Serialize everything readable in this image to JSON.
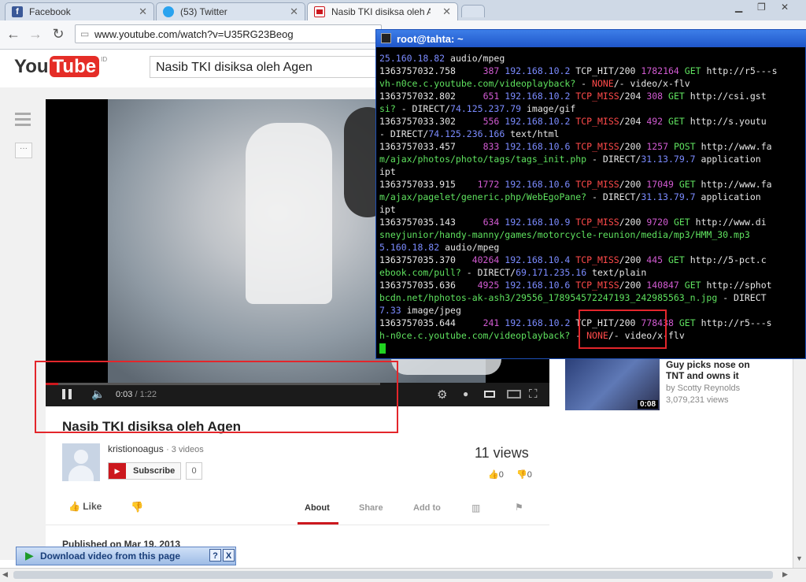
{
  "browser": {
    "tabs": [
      {
        "label": "Facebook",
        "icon": "facebook-icon",
        "color": "#3b5998"
      },
      {
        "label": "(53) Twitter",
        "icon": "twitter-icon",
        "color": "#2aa3ef"
      },
      {
        "label": "Nasib TKI disiksa oleh Agen -",
        "icon": "youtube-icon",
        "color": "#cc181e"
      }
    ],
    "url": "www.youtube.com/watch?v=U35RG23Beog"
  },
  "youtube": {
    "logo_you": "You",
    "logo_tube": "Tube",
    "logo_region": "ID",
    "search_value": "Nasib TKI disiksa oleh Agen",
    "player": {
      "time_current": "0:03",
      "time_sep": " / ",
      "time_total": "1:22",
      "progress_fraction": 0.037
    },
    "video": {
      "title": "Nasib TKI disiksa oleh Agen",
      "channel": "kristionoagus",
      "channel_videos": "· 3 videos",
      "subscribe_label": "Subscribe",
      "subscriber_count": "0",
      "views": "11 views",
      "likes": "0",
      "dislikes": "0",
      "like_label": "Like",
      "published": "Published on Mar 19, 2013"
    },
    "tabs": [
      "About",
      "Share",
      "Add to"
    ],
    "recommended": {
      "title_line1": "Guy picks nose on",
      "title_line2": "TNT and owns it",
      "author": "by Scotty Reynolds",
      "views": "3,079,231 views",
      "duration": "0:08"
    }
  },
  "terminal": {
    "title": "root@tahta: ~",
    "lines": [
      [
        [
          "c-b",
          "25.160.18.82"
        ],
        [
          "c-w",
          " audio/mpeg"
        ]
      ],
      [
        [
          "c-w",
          "1363757032.758     "
        ],
        [
          "c-m",
          "387"
        ],
        [
          "c-w",
          " "
        ],
        [
          "c-b",
          "192.168.10.2"
        ],
        [
          "c-w",
          " TCP_HIT/200 "
        ],
        [
          "c-m",
          "1782164"
        ],
        [
          "c-g",
          " GET"
        ],
        [
          "c-w",
          " http://r5---s"
        ]
      ],
      [
        [
          "c-g",
          "vh-n0ce.c.youtube.com/videoplayback?"
        ],
        [
          "c-w",
          " - "
        ],
        [
          "c-r",
          "NONE"
        ],
        [
          "c-w",
          "/- video/x-flv"
        ]
      ],
      [
        [
          "c-w",
          "1363757032.802     "
        ],
        [
          "c-m",
          "651"
        ],
        [
          "c-w",
          " "
        ],
        [
          "c-b",
          "192.168.10.2"
        ],
        [
          "c-r",
          " TCP_MISS"
        ],
        [
          "c-w",
          "/204 "
        ],
        [
          "c-m",
          "308"
        ],
        [
          "c-g",
          " GET"
        ],
        [
          "c-w",
          " http://csi.gst"
        ]
      ],
      [
        [
          "c-g",
          "si?"
        ],
        [
          "c-w",
          " - DIRECT/"
        ],
        [
          "c-b",
          "74.125.237.79"
        ],
        [
          "c-w",
          " image/gif"
        ]
      ],
      [
        [
          "c-w",
          "1363757033.302     "
        ],
        [
          "c-m",
          "556"
        ],
        [
          "c-w",
          " "
        ],
        [
          "c-b",
          "192.168.10.2"
        ],
        [
          "c-r",
          " TCP_MISS"
        ],
        [
          "c-w",
          "/204 "
        ],
        [
          "c-m",
          "492"
        ],
        [
          "c-g",
          " GET"
        ],
        [
          "c-w",
          " http://s.youtu"
        ]
      ],
      [
        [
          "c-w",
          "- DIRECT/"
        ],
        [
          "c-b",
          "74.125.236.166"
        ],
        [
          "c-w",
          " text/html"
        ]
      ],
      [
        [
          "c-w",
          "1363757033.457     "
        ],
        [
          "c-m",
          "833"
        ],
        [
          "c-w",
          " "
        ],
        [
          "c-b",
          "192.168.10.6"
        ],
        [
          "c-r",
          " TCP_MISS"
        ],
        [
          "c-w",
          "/200 "
        ],
        [
          "c-m",
          "1257"
        ],
        [
          "c-g",
          " POST"
        ],
        [
          "c-w",
          " http://www.fa"
        ]
      ],
      [
        [
          "c-g",
          "m/ajax/photos/photo/tags/tags_init.php"
        ],
        [
          "c-w",
          " - DIRECT/"
        ],
        [
          "c-b",
          "31.13.79.7"
        ],
        [
          "c-w",
          " application"
        ]
      ],
      [
        [
          "c-w",
          "ipt"
        ]
      ],
      [
        [
          "c-w",
          "1363757033.915    "
        ],
        [
          "c-m",
          "1772"
        ],
        [
          "c-w",
          " "
        ],
        [
          "c-b",
          "192.168.10.6"
        ],
        [
          "c-r",
          " TCP_MISS"
        ],
        [
          "c-w",
          "/200 "
        ],
        [
          "c-m",
          "17049"
        ],
        [
          "c-g",
          " GET"
        ],
        [
          "c-w",
          " http://www.fa"
        ]
      ],
      [
        [
          "c-g",
          "m/ajax/pagelet/generic.php/WebEgoPane?"
        ],
        [
          "c-w",
          " - DIRECT/"
        ],
        [
          "c-b",
          "31.13.79.7"
        ],
        [
          "c-w",
          " application"
        ]
      ],
      [
        [
          "c-w",
          "ipt"
        ]
      ],
      [
        [
          "c-w",
          "1363757035.143     "
        ],
        [
          "c-m",
          "634"
        ],
        [
          "c-w",
          " "
        ],
        [
          "c-b",
          "192.168.10.9"
        ],
        [
          "c-r",
          " TCP_MISS"
        ],
        [
          "c-w",
          "/200 "
        ],
        [
          "c-m",
          "9720"
        ],
        [
          "c-g",
          " GET"
        ],
        [
          "c-w",
          " http://www.di"
        ]
      ],
      [
        [
          "c-g",
          "sneyjunior/handy-manny/games/motorcycle-reunion/media/mp3/HMM_30.mp3"
        ]
      ],
      [
        [
          "c-b",
          "5.160.18.82"
        ],
        [
          "c-w",
          " audio/mpeg"
        ]
      ],
      [
        [
          "c-w",
          "1363757035.370   "
        ],
        [
          "c-m",
          "40264"
        ],
        [
          "c-w",
          " "
        ],
        [
          "c-b",
          "192.168.10.4"
        ],
        [
          "c-r",
          " TCP_MISS"
        ],
        [
          "c-w",
          "/200 "
        ],
        [
          "c-m",
          "445"
        ],
        [
          "c-g",
          " GET"
        ],
        [
          "c-w",
          " http://5-pct.c"
        ]
      ],
      [
        [
          "c-g",
          "ebook.com/pull?"
        ],
        [
          "c-w",
          " - DIRECT/"
        ],
        [
          "c-b",
          "69.171.235.16"
        ],
        [
          "c-w",
          " text/plain"
        ]
      ],
      [
        [
          "c-w",
          "1363757035.636    "
        ],
        [
          "c-m",
          "4925"
        ],
        [
          "c-w",
          " "
        ],
        [
          "c-b",
          "192.168.10.6"
        ],
        [
          "c-r",
          " TCP_MISS"
        ],
        [
          "c-w",
          "/200 "
        ],
        [
          "c-m",
          "140847"
        ],
        [
          "c-g",
          " GET"
        ],
        [
          "c-w",
          " http://sphot"
        ]
      ],
      [
        [
          "c-g",
          "bcdn.net/hphotos-ak-ash3/29556_178954572247193_242985563_n.jpg"
        ],
        [
          "c-w",
          " - DIRECT"
        ]
      ],
      [
        [
          "c-b",
          "7.33"
        ],
        [
          "c-w",
          " image/jpeg"
        ]
      ],
      [
        [
          "c-w",
          "1363757035.644     "
        ],
        [
          "c-m",
          "241"
        ],
        [
          "c-w",
          " "
        ],
        [
          "c-b",
          "192.168.10.2"
        ],
        [
          "c-w",
          " TCP_HIT/200 "
        ],
        [
          "c-m",
          "778438"
        ],
        [
          "c-g",
          " GET"
        ],
        [
          "c-w",
          " http://r5---s"
        ]
      ],
      [
        [
          "c-g",
          "h-n0ce.c.youtube.com/videoplayback?"
        ],
        [
          "c-w",
          " - "
        ],
        [
          "c-r",
          "NONE"
        ],
        [
          "c-w",
          "/- video/x-flv"
        ]
      ]
    ]
  },
  "download_bar": {
    "label": "Download video from this page",
    "help": "?",
    "close": "X"
  },
  "colors": {
    "highlight": "#e3262b",
    "yt_red": "#cc181e",
    "terminal_title": "#2a64d8"
  }
}
